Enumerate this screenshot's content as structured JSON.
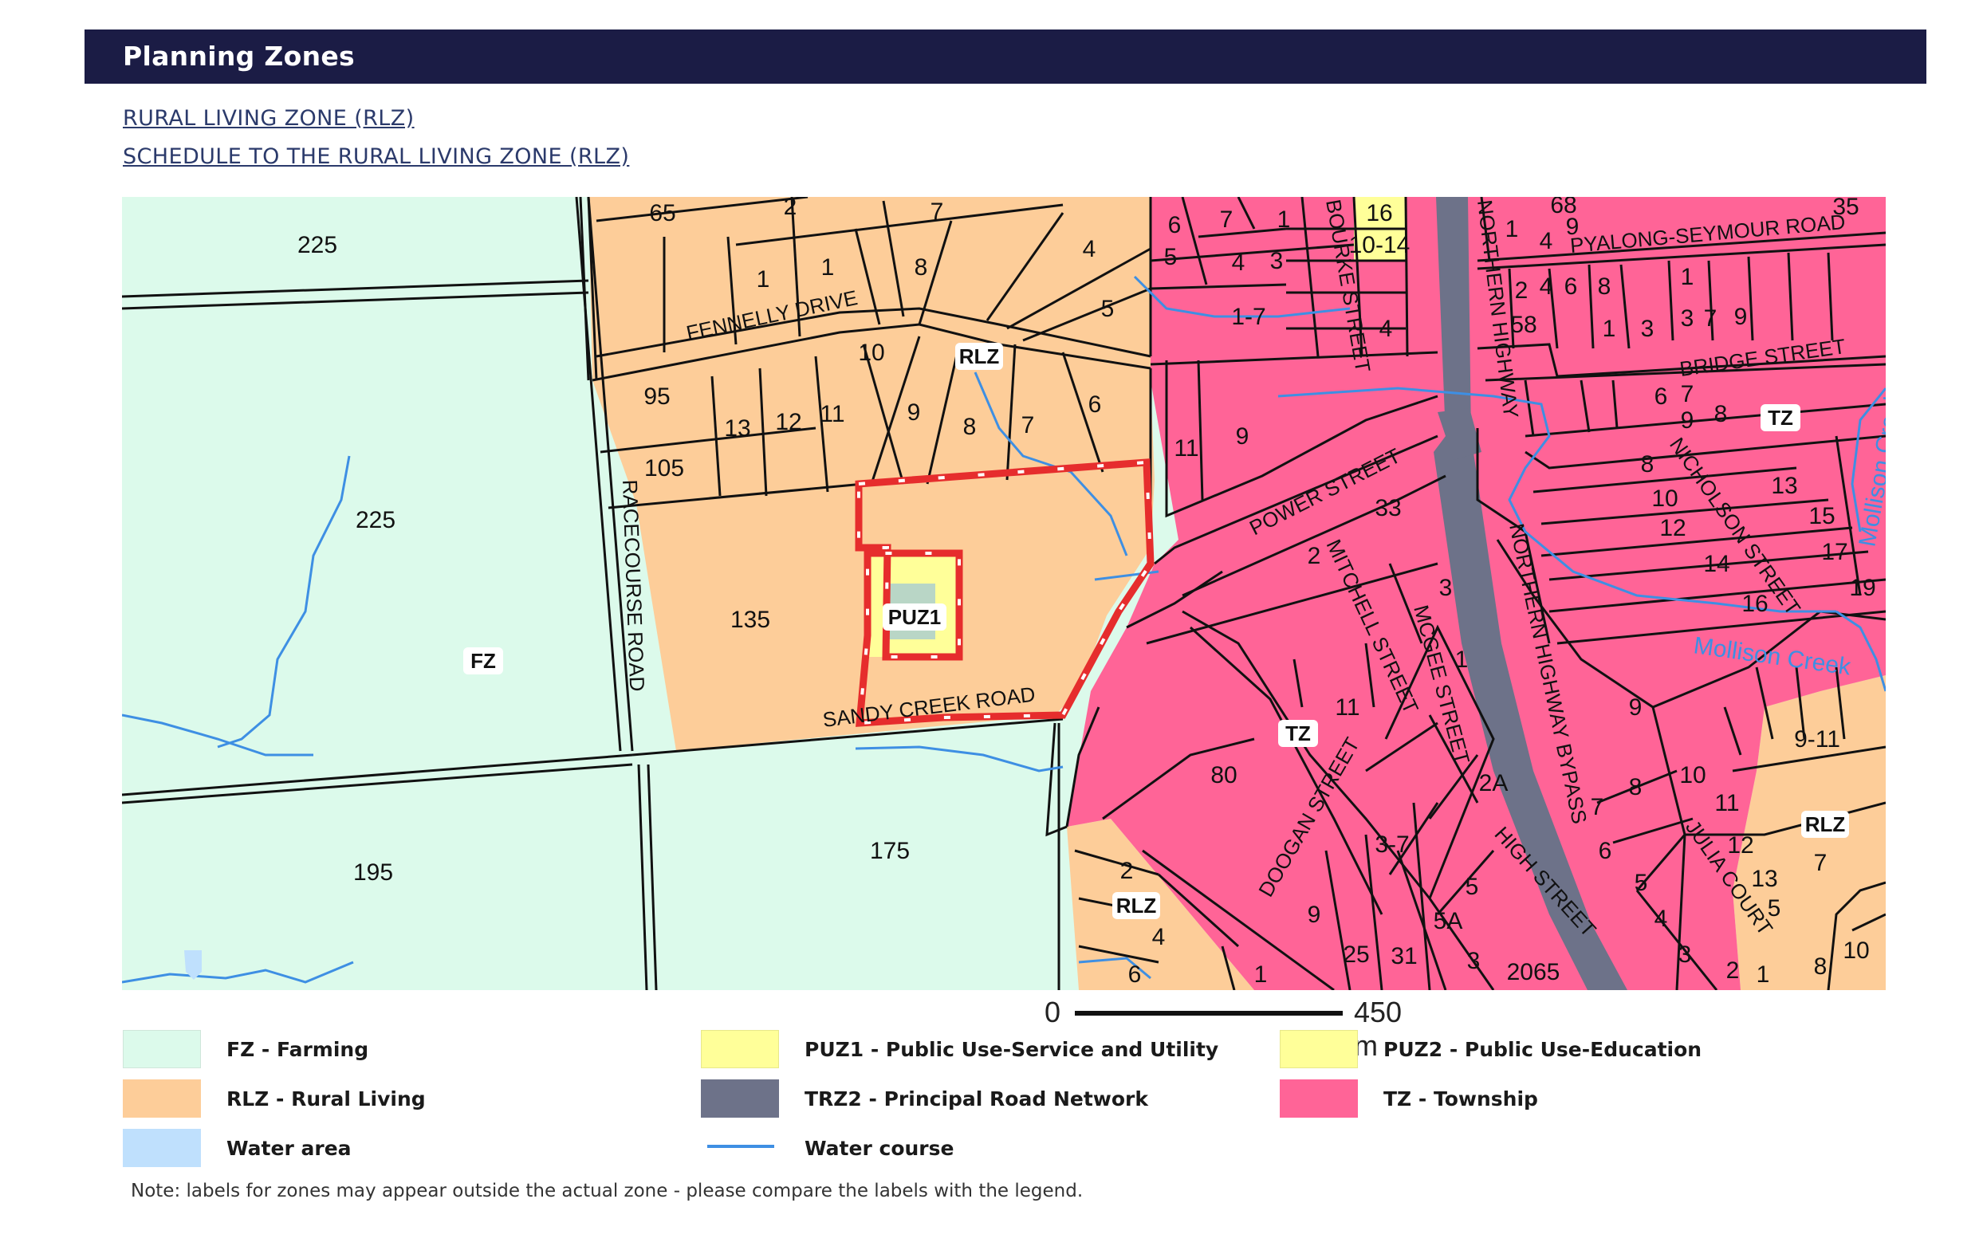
{
  "header": {
    "title": "Planning Zones"
  },
  "links": [
    {
      "label": "RURAL LIVING ZONE (RLZ)"
    },
    {
      "label": "SCHEDULE TO THE RURAL LIVING ZONE (RLZ)"
    }
  ],
  "map": {
    "zone_labels": [
      "RLZ",
      "PUZ1",
      "FZ",
      "TZ",
      "TZ",
      "RLZ",
      "RLZ",
      "TZ"
    ],
    "parcel_numbers": [
      "225",
      "225",
      "195",
      "175",
      "135",
      "65",
      "2",
      "7",
      "1",
      "1",
      "8",
      "4",
      "5",
      "95",
      "105",
      "13",
      "12",
      "11",
      "10",
      "9",
      "8",
      "7",
      "6",
      "6",
      "7",
      "1",
      "5",
      "4",
      "3",
      "1-7",
      "16",
      "10-14",
      "4",
      "1",
      "4",
      "68",
      "9",
      "35",
      "2",
      "4",
      "6",
      "8",
      "58",
      "1",
      "3",
      "1",
      "3",
      "7",
      "9",
      "6",
      "7",
      "9",
      "8",
      "11",
      "9",
      "33",
      "2",
      "3",
      "1",
      "11",
      "80",
      "2A",
      "3-7",
      "9",
      "25",
      "31",
      "5A",
      "3",
      "5",
      "2065",
      "8",
      "10",
      "12",
      "14",
      "16",
      "13",
      "15",
      "17",
      "19",
      "9",
      "9-11",
      "10",
      "8",
      "7",
      "11",
      "12",
      "13",
      "5",
      "6",
      "5",
      "4",
      "3",
      "2",
      "1",
      "7",
      "8",
      "10",
      "2",
      "4",
      "6",
      "1"
    ],
    "road_labels": [
      "FENNELLY DRIVE",
      "RACECOURSE ROAD",
      "SANDY CREEK ROAD",
      "POWER STREET",
      "NORTHERN HIGHWAY",
      "NORTHERN HIGHWAY BYPASS",
      "BOURKE STREET",
      "PYALONG-SEYMOUR ROAD",
      "BRIDGE STREET",
      "NICHOLSON STREET",
      "DOOGAN STREET",
      "HIGH STREET",
      "MITCHELL STREET",
      "MCGEE STREET",
      "JULIA COURT"
    ],
    "creek_labels": [
      "Mollison Creek",
      "Mollison Creek"
    ],
    "scale": {
      "zero": "0",
      "distance": "450 m"
    }
  },
  "legend": [
    {
      "code_label": "FZ - Farming",
      "color": "#dcfaeb"
    },
    {
      "code_label": "PUZ1 - Public Use-Service and Utility",
      "color": "#ffff99"
    },
    {
      "code_label": "PUZ2 - Public Use-Education",
      "color": "#ffff99"
    },
    {
      "code_label": "RLZ - Rural Living",
      "color": "#fdcd99"
    },
    {
      "code_label": "TRZ2 - Principal Road Network",
      "color": "#6d7289"
    },
    {
      "code_label": "TZ - Township",
      "color": "#ff6497"
    },
    {
      "code_label": "Water area",
      "color": "#bfe0fd"
    },
    {
      "code_label": "Water course",
      "color": "#3e8fe3"
    }
  ],
  "note": "Note: labels for zones may appear outside the actual zone - please compare the labels with the legend."
}
